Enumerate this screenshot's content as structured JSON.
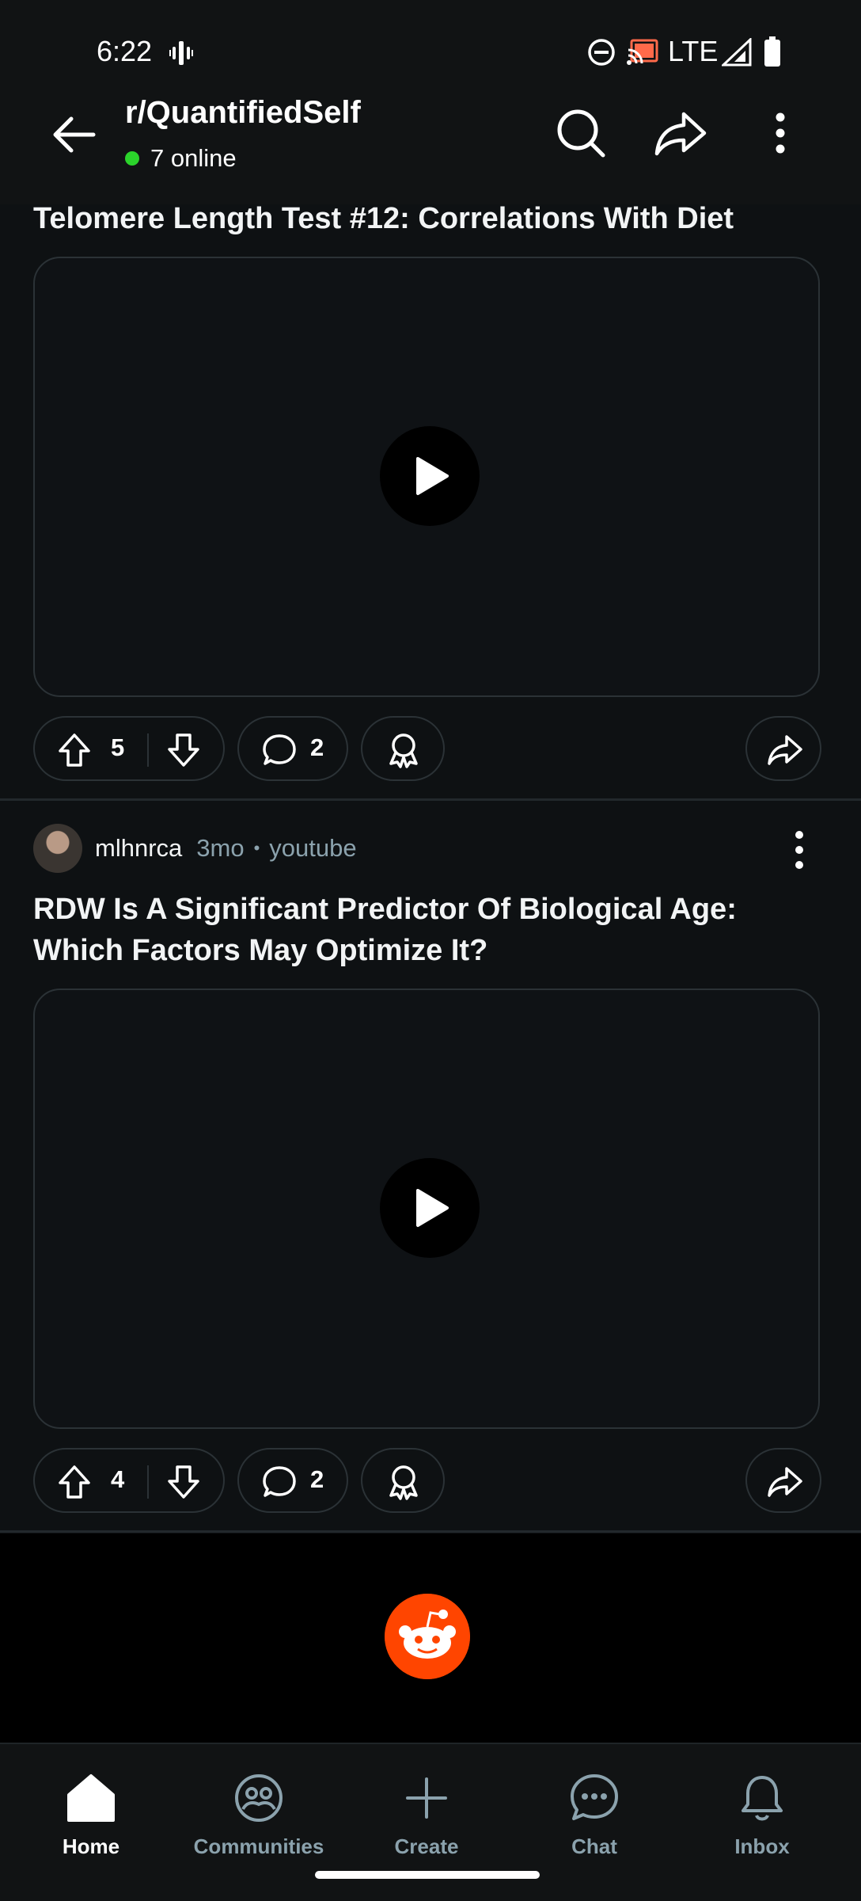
{
  "status_bar": {
    "time": "6:22",
    "network": "LTE",
    "icons": [
      "vibrate-icon",
      "do-not-disturb-icon",
      "cast-icon",
      "signal-icon",
      "battery-icon"
    ]
  },
  "header": {
    "subreddit": "r/QuantifiedSelf",
    "online_text": "7 online",
    "online_color": "#2bd32b",
    "icons": [
      "back-arrow-icon",
      "search-icon",
      "share-icon",
      "more-vert-icon"
    ]
  },
  "posts": [
    {
      "title": "Telomere Length Test #12: Correlations With Diet",
      "upvotes": "5",
      "comments": "2"
    },
    {
      "author": "mlhnrca",
      "age": "3mo",
      "separator": "•",
      "domain": "youtube",
      "title": "RDW Is A Significant Predictor Of Biological Age: Which Factors May Optimize It?",
      "upvotes": "4",
      "comments": "2"
    }
  ],
  "bottom_nav": {
    "items": [
      {
        "label": "Home",
        "icon": "home-icon",
        "active": true
      },
      {
        "label": "Communities",
        "icon": "communities-icon",
        "active": false
      },
      {
        "label": "Create",
        "icon": "plus-icon",
        "active": false
      },
      {
        "label": "Chat",
        "icon": "chat-icon",
        "active": false
      },
      {
        "label": "Inbox",
        "icon": "bell-icon",
        "active": false
      }
    ]
  },
  "colors": {
    "background": "#0e1113",
    "accent": "#ff4500",
    "muted_text": "#8ba2ad",
    "border": "#2b3236"
  }
}
